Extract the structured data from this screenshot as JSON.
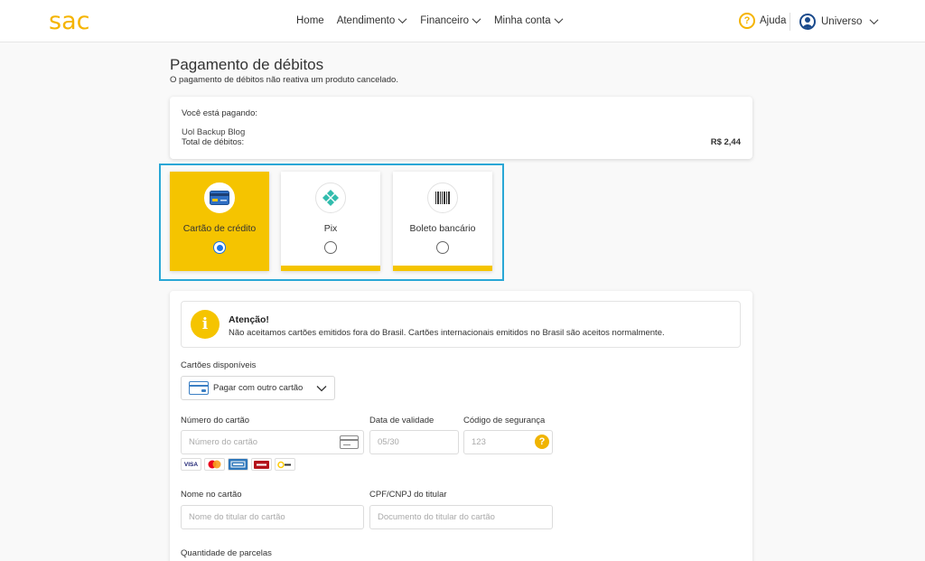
{
  "header": {
    "logo": "sac",
    "nav": [
      {
        "label": "Home",
        "has_dropdown": false
      },
      {
        "label": "Atendimento",
        "has_dropdown": true
      },
      {
        "label": "Financeiro",
        "has_dropdown": true
      },
      {
        "label": "Minha conta",
        "has_dropdown": true
      }
    ],
    "help_label": "Ajuda",
    "help_icon": "question-icon",
    "user_label": "Universo",
    "user_icon": "user-icon"
  },
  "page": {
    "title": "Pagamento de débitos",
    "subtitle": "O pagamento de débitos não reativa um produto cancelado."
  },
  "summary": {
    "paying_label": "Você está pagando:",
    "product": "Uol Backup Blog",
    "total_label": "Total de débitos:",
    "total_value": "R$ 2,44"
  },
  "payment_methods": [
    {
      "label": "Cartão de crédito",
      "icon": "credit-card-icon",
      "selected": true
    },
    {
      "label": "Pix",
      "icon": "pix-icon",
      "selected": false
    },
    {
      "label": "Boleto bancário",
      "icon": "barcode-icon",
      "selected": false
    }
  ],
  "alert": {
    "icon": "info-icon",
    "title": "Atenção!",
    "text": "Não aceitamos cartões emitidos fora do Brasil. Cartões internacionais emitidos no Brasil são aceitos normalmente."
  },
  "form": {
    "cards_available_label": "Cartões disponíveis",
    "cards_available_value": "Pagar com outro cartão",
    "card_number_label": "Número do cartão",
    "card_number_placeholder": "Número do cartão",
    "expiry_label": "Data de validade",
    "expiry_placeholder": "05/30",
    "cvv_label": "Código de segurança",
    "cvv_placeholder": "123",
    "name_label": "Nome no cartão",
    "name_placeholder": "Nome do titular do cartão",
    "doc_label": "CPF/CNPJ do titular",
    "doc_placeholder": "Documento do titular do cartão",
    "installments_label": "Quantidade de parcelas",
    "brands": [
      "VISA",
      "mastercard",
      "amex",
      "hipercard",
      "elo"
    ]
  },
  "colors": {
    "brand_yellow": "#f5c400",
    "selection_frame": "#29a7d6",
    "radio_blue": "#1a73e8"
  }
}
